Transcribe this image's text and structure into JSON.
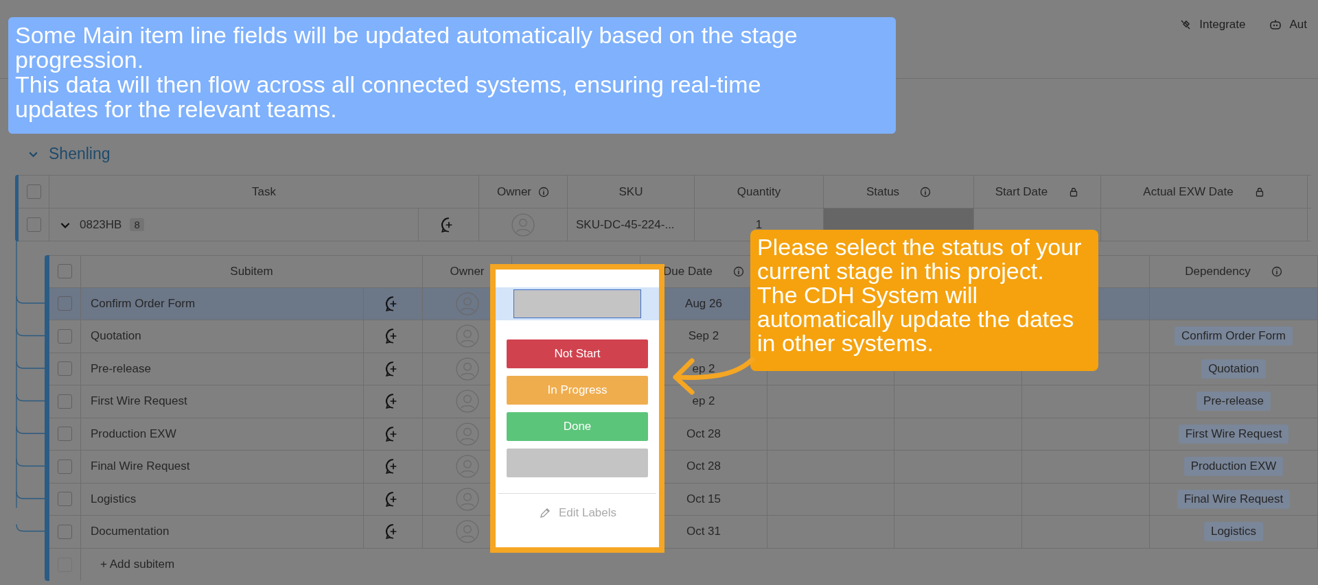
{
  "toolbar": {
    "items": [
      {
        "kind": "integrate",
        "label": "Integrate"
      },
      {
        "kind": "automate",
        "label": "Aut"
      }
    ]
  },
  "tip_banner": {
    "paragraphs": [
      "Some Main item line fields will be updated automatically based on the stage progression.",
      "This data will then flow across all connected systems, ensuring real-time updates for the relevant teams."
    ]
  },
  "group": {
    "name": "Shenling",
    "expanded": true
  },
  "main_table": {
    "columns": {
      "task": "Task",
      "owner": "Owner",
      "sku": "SKU",
      "quantity": "Quantity",
      "status": "Status",
      "start_date": "Start Date",
      "actual_exw_date": "Actual EXW Date"
    },
    "header_checked": false,
    "rows": [
      {
        "task": "0823HB",
        "subitem_count": "8",
        "expanded": true,
        "checked": false,
        "sku": "SKU-DC-45-224-...",
        "quantity": "1"
      }
    ]
  },
  "subitems": {
    "columns": {
      "subitem": "Subitem",
      "owner": "Owner",
      "due_date": "Due Date",
      "dependency": "Dependency"
    },
    "header_checked": false,
    "rows": [
      {
        "name": "Confirm Order Form",
        "due_date": "Aug 26",
        "selected": true,
        "checked": false
      },
      {
        "name": "Quotation",
        "due_date": "Sep 2",
        "selected": false,
        "checked": false,
        "dependency": "Confirm Order Form"
      },
      {
        "name": "Pre-release",
        "due_date": "ep 2",
        "selected": false,
        "checked": false,
        "dependency": "Quotation"
      },
      {
        "name": "First Wire Request",
        "due_date": "ep 2",
        "selected": false,
        "checked": false,
        "dependency": "Pre-release"
      },
      {
        "name": "Production EXW",
        "due_date": "Oct 28",
        "selected": false,
        "checked": false,
        "dependency": "First Wire Request"
      },
      {
        "name": "Final Wire Request",
        "due_date": "Oct 28",
        "selected": false,
        "checked": false,
        "dependency": "Production EXW"
      },
      {
        "name": "Logistics",
        "due_date": "Oct 15",
        "selected": false,
        "checked": false,
        "dependency": "Final Wire Request"
      },
      {
        "name": "Documentation",
        "due_date": "Oct 31",
        "selected": false,
        "checked": false,
        "dependency": "Logistics"
      }
    ],
    "add_row": "+ Add subitem",
    "add_row_checked": false
  },
  "status_picker": {
    "options": [
      {
        "label": "Not Start",
        "color": "#d1424f"
      },
      {
        "label": "In Progress",
        "color": "#f0ad4e"
      },
      {
        "label": "Done",
        "color": "#5bc57a"
      },
      {
        "color": "#c4c4c4"
      }
    ],
    "edit_labels": "Edit Labels"
  },
  "callout": {
    "lines": [
      "Please select the status of your",
      "current stage in this project.",
      "The CDH System will",
      "automatically update the dates",
      "in other systems."
    ]
  }
}
